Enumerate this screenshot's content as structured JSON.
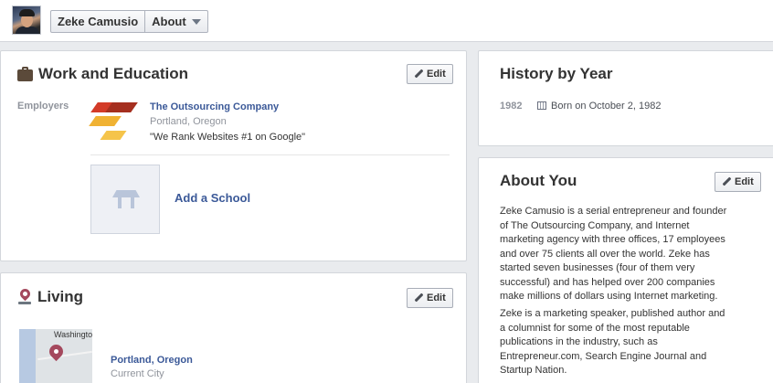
{
  "header": {
    "profile_name": "Zeke Camusio",
    "section_label": "About"
  },
  "work_education": {
    "title": "Work and Education",
    "edit_label": "Edit",
    "employers_label": "Employers",
    "employer": {
      "name": "The Outsourcing Company",
      "location": "Portland, Oregon",
      "description": "\"We Rank Websites #1 on Google\""
    },
    "add_school_label": "Add a School"
  },
  "living": {
    "title": "Living",
    "edit_label": "Edit",
    "map_label": "Washington",
    "city": "Portland, Oregon",
    "city_type": "Current City"
  },
  "history": {
    "title": "History by Year",
    "year": "1982",
    "event": "Born on October 2, 1982"
  },
  "about_you": {
    "title": "About You",
    "edit_label": "Edit",
    "paragraph1_lines": [
      "Zeke Camusio is a serial entrepreneur and founder",
      "of The Outsourcing Company, and Internet",
      "marketing agency with three offices, 17 employees",
      "and over 75 clients all over the world. Zeke has",
      "started seven businesses (four of them very",
      "successful) and has helped over 200 companies",
      "make millions of dollars using Internet marketing."
    ],
    "paragraph2_lines": [
      "Zeke is a marketing speaker, published author and",
      "a columnist for some of the most reputable",
      "publications in the industry, such as",
      "Entrepreneur.com, Search Engine Journal and",
      "Startup Nation."
    ]
  },
  "colors": {
    "link": "#3b5998",
    "background": "#e9ebee",
    "pin": "#a4485d"
  },
  "icons": [
    "briefcase-icon",
    "location-pin-icon",
    "pencil-icon",
    "calendar-icon",
    "chevron-down-icon",
    "school-icon"
  ]
}
